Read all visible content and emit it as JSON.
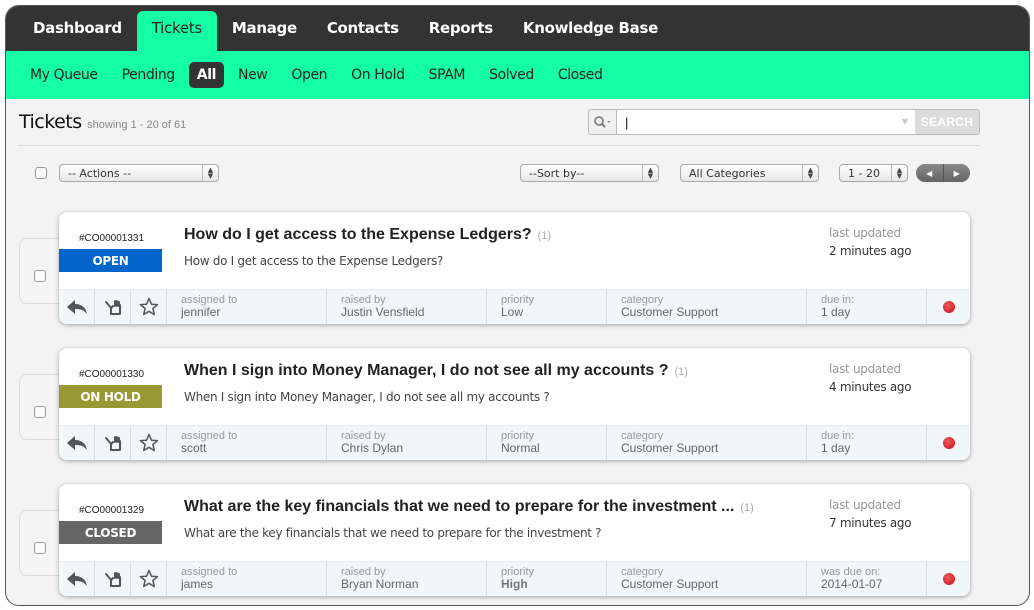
{
  "topnav": {
    "tabs": [
      {
        "label": "Dashboard",
        "active": false
      },
      {
        "label": "Tickets",
        "active": true
      },
      {
        "label": "Manage",
        "active": false
      },
      {
        "label": "Contacts",
        "active": false
      },
      {
        "label": "Reports",
        "active": false
      },
      {
        "label": "Knowledge Base",
        "active": false
      }
    ]
  },
  "subnav": {
    "items": [
      {
        "label": "My Queue",
        "active": false
      },
      {
        "label": "Pending",
        "active": false
      },
      {
        "label": "All",
        "active": true
      },
      {
        "label": "New",
        "active": false
      },
      {
        "label": "Open",
        "active": false
      },
      {
        "label": "On Hold",
        "active": false
      },
      {
        "label": "SPAM",
        "active": false
      },
      {
        "label": "Solved",
        "active": false
      },
      {
        "label": "Closed",
        "active": false
      }
    ]
  },
  "header": {
    "title": "Tickets",
    "subtitle": "showing 1 - 20 of 61",
    "search": {
      "value": "|",
      "placeholder": "",
      "button_label": "SEARCH"
    }
  },
  "toolbar": {
    "actions_select": "-- Actions --",
    "sort_select": "--Sort by--",
    "category_select": "All Categories",
    "range_select": "1 - 20",
    "prev_label": "◀",
    "next_label": "▶"
  },
  "colors": {
    "accent": "#14ffa5",
    "nav_dark": "#333333",
    "status_open": "#0066cc",
    "status_on_hold": "#999933",
    "status_closed": "#666666",
    "alert_dot": "#d9141e"
  },
  "tickets": [
    {
      "id": "#CO00001331",
      "status": "OPEN",
      "status_color": "#0066cc",
      "title": "How do I get access to the Expense Ledgers?",
      "count": "(1)",
      "description": "How do I get access to the Expense Ledgers?",
      "updated_label": "last updated",
      "updated_value": "2 minutes ago",
      "assigned_label": "assigned to",
      "assigned": "jennifer",
      "raised_label": "raised by",
      "raised": "Justin Vensfield",
      "priority_label": "priority",
      "priority": "Low",
      "category_label": "category",
      "category": "Customer Support",
      "due_label": "due in:",
      "due": "1 day"
    },
    {
      "id": "#CO00001330",
      "status": "ON HOLD",
      "status_color": "#999933",
      "title": "When I sign into Money Manager, I do not see all my accounts ?",
      "count": "(1)",
      "description": "When I sign into Money Manager, I do not see all my accounts ?",
      "updated_label": "last updated",
      "updated_value": "4 minutes ago",
      "assigned_label": "assigned to",
      "assigned": "scott",
      "raised_label": "raised by",
      "raised": "Chris Dylan",
      "priority_label": "priority",
      "priority": "Normal",
      "category_label": "category",
      "category": "Customer Support",
      "due_label": "due in:",
      "due": "1 day"
    },
    {
      "id": "#CO00001329",
      "status": "CLOSED",
      "status_color": "#666666",
      "title": "What are the key financials that we need to prepare for the investment ...",
      "count": "(1)",
      "description": "What are the key financials that we need to prepare for the investment ?",
      "updated_label": "last updated",
      "updated_value": "7 minutes ago",
      "assigned_label": "assigned to",
      "assigned": "james",
      "raised_label": "raised by",
      "raised": "Bryan Norman",
      "priority_label": "priority",
      "priority": "High",
      "category_label": "category",
      "category": "Customer Support",
      "due_label": "was due on:",
      "due": "2014-01-07"
    }
  ]
}
